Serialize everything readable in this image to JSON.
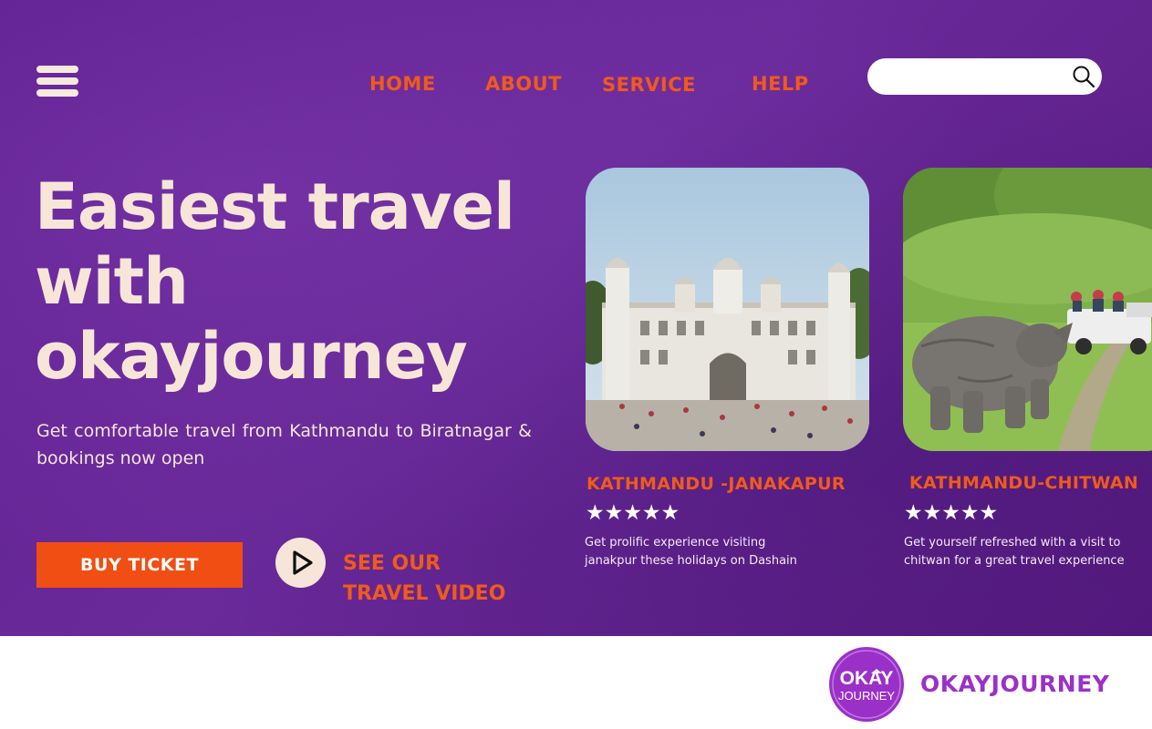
{
  "nav": {
    "items": [
      {
        "label": "HOME"
      },
      {
        "label": "ABOUT"
      },
      {
        "label": "SERVICE"
      },
      {
        "label": "HELP"
      }
    ],
    "search_placeholder": "",
    "menu_icon": "hamburger-menu-icon",
    "search_icon": "magnifier-search-icon"
  },
  "hero": {
    "title_lines": [
      "Easiest travel",
      "with",
      "okayjourney"
    ],
    "subtitle": "Get comfortable travel from Kathmandu to Biratnagar & bookings now open",
    "buy_button": "BUY TICKET",
    "play_icon": "play-icon",
    "video_lines": [
      "SEE OUR",
      "TRAVEL VIDEO"
    ]
  },
  "cards": [
    {
      "title": "KATHMANDU -JANAKAPUR",
      "stars": "★★★★★",
      "rating": 5,
      "description_lines": [
        "Get prolific experience visiting",
        "janakpur these holidays on Dashain"
      ]
    },
    {
      "title": "KATHMANDU-CHITWAN",
      "stars": "★★★★★",
      "rating": 5,
      "description_lines": [
        "Get yourself refreshed with a visit to",
        "chitwan for a great travel experience"
      ]
    }
  ],
  "footer": {
    "logo_text": [
      "OKAY",
      "JOURNEY"
    ],
    "brand": "OKAYJOURNEY"
  },
  "colors": {
    "hero_bg": "#5e1f8f",
    "accent": "#f04e12",
    "nav_text": "#f15a1a",
    "title_text": "#f7e6d8",
    "brand_purple": "#9b30c8"
  }
}
